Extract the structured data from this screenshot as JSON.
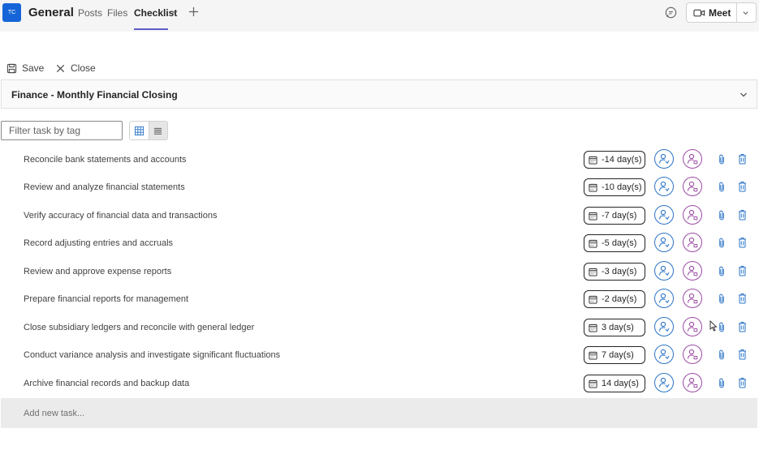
{
  "header": {
    "team_avatar": "TC",
    "channel": "General",
    "tabs": [
      {
        "label": "Posts"
      },
      {
        "label": "Files"
      },
      {
        "label": "Checklist"
      }
    ],
    "meet_label": "Meet"
  },
  "toolbar": {
    "save_label": "Save",
    "close_label": "Close"
  },
  "section": {
    "title": "Finance - Monthly Financial Closing"
  },
  "filter": {
    "placeholder": "Filter task by tag"
  },
  "tasks": [
    {
      "label": "Reconcile bank statements and accounts",
      "due": "-14 day(s)"
    },
    {
      "label": "Review and analyze financial statements",
      "due": "-10 day(s)"
    },
    {
      "label": "Verify accuracy of financial data and transactions",
      "due": "-7 day(s)"
    },
    {
      "label": "Record adjusting entries and accruals",
      "due": "-5 day(s)"
    },
    {
      "label": "Review and approve expense reports",
      "due": "-3 day(s)"
    },
    {
      "label": "Prepare financial reports for management",
      "due": "-2 day(s)"
    },
    {
      "label": "Close subsidiary ledgers and reconcile with general ledger",
      "due": "3 day(s)"
    },
    {
      "label": "Conduct variance analysis and investigate significant fluctuations",
      "due": "7 day(s)"
    },
    {
      "label": "Archive financial records and backup data",
      "due": "14 day(s)"
    }
  ],
  "add_task": {
    "placeholder": "Add new task..."
  },
  "colors": {
    "accent": "#5b5fc7",
    "team_avatar": "#1565d8",
    "assignee": "#2b74c7",
    "approver": "#9c4aa5",
    "delete": "#2b74c7"
  },
  "icons": {
    "save": "save-icon",
    "close": "close-icon",
    "due": "calendar-icon",
    "assign": "person-arrow-icon",
    "approve": "person-check-icon",
    "attach": "paperclip-icon",
    "delete": "trash-icon"
  }
}
